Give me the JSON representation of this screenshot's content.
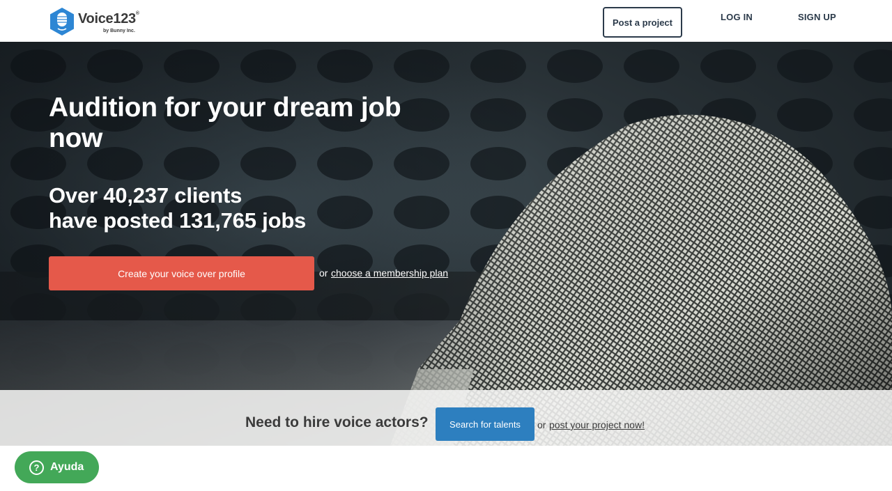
{
  "header": {
    "logo_text": "Voice123",
    "logo_reg": "®",
    "logo_tagline": "by Bunny Inc.",
    "post_project_label": "Post a project",
    "login_label": "LOG IN",
    "signup_label": "SIGN UP"
  },
  "hero": {
    "title": "Audition for your dream job now",
    "stats_line1": "Over 40,237 clients",
    "stats_line2": "have posted 131,765 jobs",
    "cta_label": "Create your voice over profile",
    "or_text": "or",
    "membership_link": "choose a membership plan"
  },
  "hire": {
    "question": "Need to hire voice actors?",
    "search_label": "Search for talents",
    "or_text": "or",
    "post_link": "post your project now!"
  },
  "help": {
    "icon_glyph": "?",
    "label": "Ayuda"
  },
  "colors": {
    "brand_blue": "#2d86d4",
    "cta_red": "#e5594a",
    "search_blue": "#2d7fbf",
    "help_green": "#43a858",
    "nav_text": "#2b3a4a"
  },
  "icons": {
    "logo": "microphone-hexagon-logo",
    "help": "question-circle-icon"
  }
}
